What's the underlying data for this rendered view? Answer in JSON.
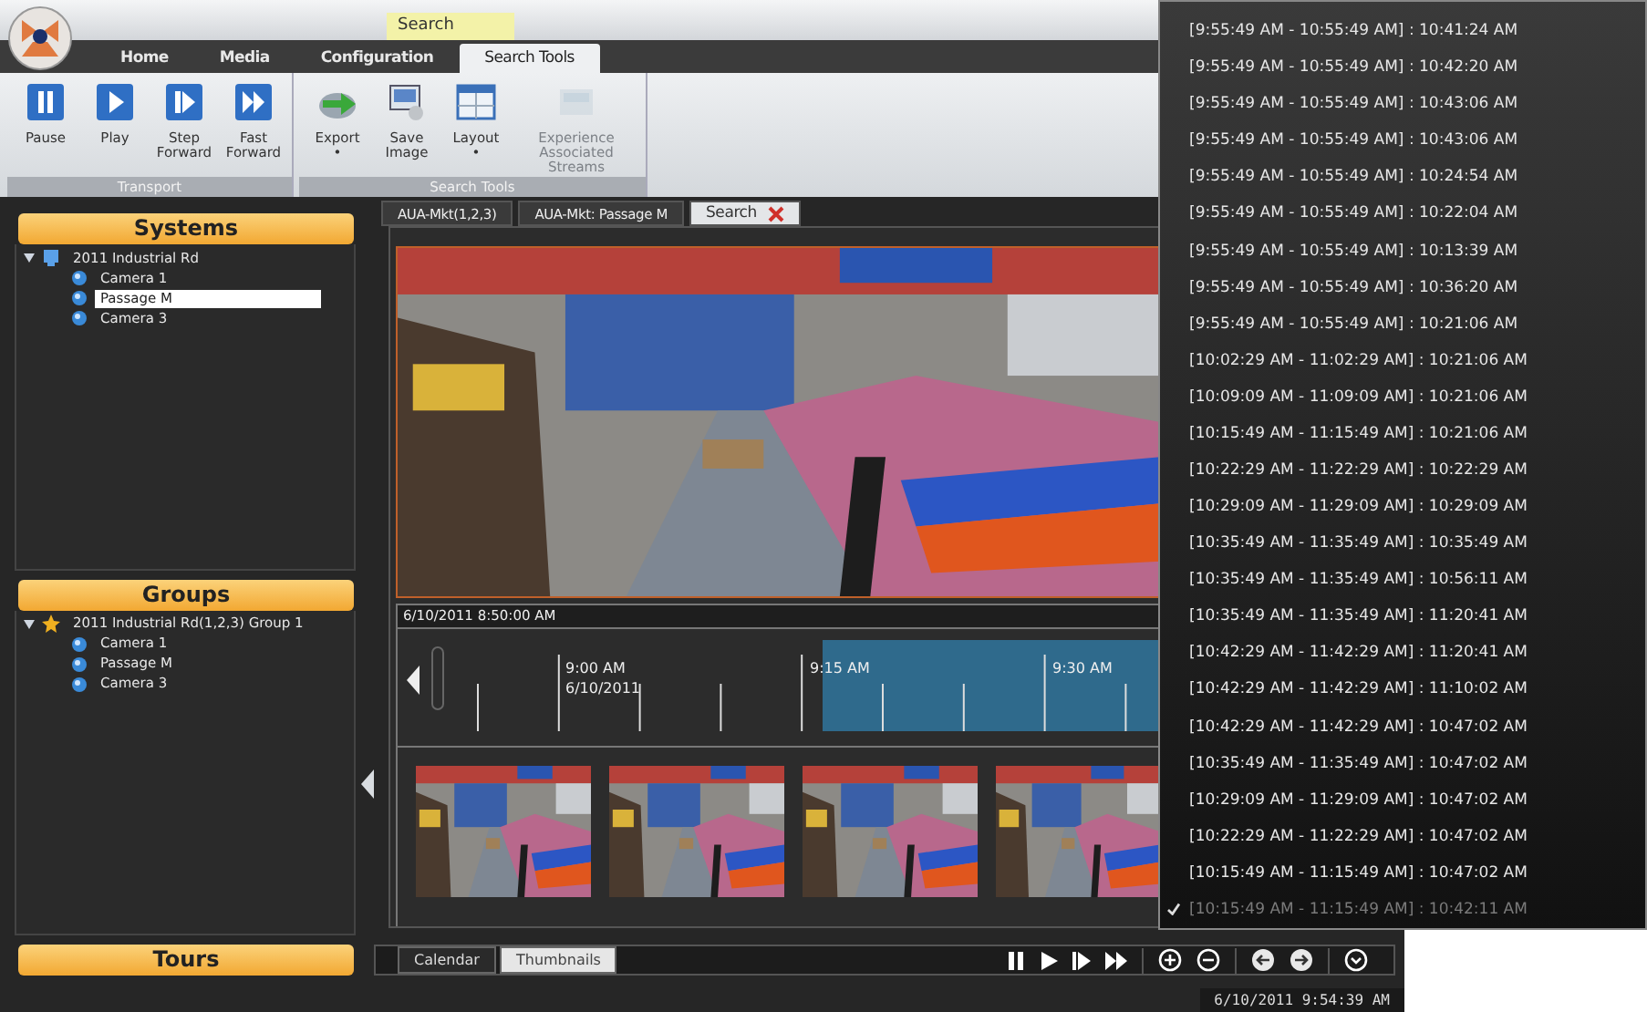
{
  "contextual_tab": {
    "label": "Search"
  },
  "ribbon_tabs": [
    {
      "label": "Home",
      "selected": false
    },
    {
      "label": "Media",
      "selected": false
    },
    {
      "label": "Configuration",
      "selected": false
    },
    {
      "label": "Search Tools",
      "selected": true
    }
  ],
  "ribbon_groups": [
    {
      "label": "Transport",
      "buttons": [
        {
          "label": "Pause",
          "kind": "pause",
          "disabled": false
        },
        {
          "label": "Play",
          "kind": "play",
          "disabled": false
        },
        {
          "label": "Step Forward",
          "kind": "step",
          "disabled": false
        },
        {
          "label": "Fast Forward",
          "kind": "fast",
          "disabled": false
        }
      ]
    },
    {
      "label": "Search Tools",
      "buttons": [
        {
          "label": "Export",
          "kind": "export",
          "dropdown": "•",
          "disabled": false
        },
        {
          "label": "Save Image",
          "kind": "save",
          "disabled": false
        },
        {
          "label": "Layout",
          "kind": "layout",
          "dropdown": "•",
          "disabled": false
        },
        {
          "label": "Experience Associated Streams",
          "kind": "streams",
          "disabled": true
        }
      ]
    }
  ],
  "sidebar": {
    "systems": {
      "title": "Systems",
      "tree": [
        {
          "label": "2011 Industrial Rd",
          "kind": "site",
          "expanded": true,
          "children": [
            {
              "label": "Camera 1",
              "kind": "camera",
              "selected": false
            },
            {
              "label": "Passage M",
              "kind": "camera",
              "selected": true
            },
            {
              "label": "Camera 3",
              "kind": "camera",
              "selected": false
            }
          ]
        }
      ]
    },
    "groups": {
      "title": "Groups",
      "tree": [
        {
          "label": "2011 Industrial Rd(1,2,3) Group 1",
          "kind": "group",
          "expanded": true,
          "children": [
            {
              "label": "Camera 1",
              "kind": "camera",
              "selected": false
            },
            {
              "label": "Passage M",
              "kind": "camera",
              "selected": false
            },
            {
              "label": "Camera 3",
              "kind": "camera",
              "selected": false
            }
          ]
        }
      ]
    },
    "tours": {
      "title": "Tours"
    }
  },
  "document_tabs": [
    {
      "label": "AUA-Mkt(1,2,3)",
      "selected": false,
      "closable": false
    },
    {
      "label": "AUA-Mkt: Passage M",
      "selected": false,
      "closable": false
    },
    {
      "label": "Search",
      "selected": true,
      "closable": true
    }
  ],
  "timeline": {
    "start": "6/10/2011 8:50:00 AM",
    "labels": [
      {
        "time": "9:00 AM",
        "date": "6/10/2011"
      },
      {
        "time": "9:15 AM"
      },
      {
        "time": "9:30 AM"
      }
    ]
  },
  "view_tabs": [
    {
      "label": "Calendar",
      "selected": false
    },
    {
      "label": "Thumbnails",
      "selected": true
    }
  ],
  "status": {
    "timestamp": "6/10/2011 9:54:39 AM"
  },
  "results": [
    {
      "label": "[9:55:49 AM - 10:55:49 AM] : 10:41:24 AM",
      "selected": false
    },
    {
      "label": "[9:55:49 AM - 10:55:49 AM] : 10:42:20 AM",
      "selected": false
    },
    {
      "label": "[9:55:49 AM - 10:55:49 AM] : 10:43:06 AM",
      "selected": false
    },
    {
      "label": "[9:55:49 AM - 10:55:49 AM] : 10:43:06 AM",
      "selected": false
    },
    {
      "label": "[9:55:49 AM - 10:55:49 AM] : 10:24:54 AM",
      "selected": false
    },
    {
      "label": "[9:55:49 AM - 10:55:49 AM] : 10:22:04 AM",
      "selected": false
    },
    {
      "label": "[9:55:49 AM - 10:55:49 AM] : 10:13:39 AM",
      "selected": false
    },
    {
      "label": "[9:55:49 AM - 10:55:49 AM] : 10:36:20 AM",
      "selected": false
    },
    {
      "label": "[9:55:49 AM - 10:55:49 AM] : 10:21:06 AM",
      "selected": false
    },
    {
      "label": "[10:02:29 AM - 11:02:29 AM] : 10:21:06 AM",
      "selected": false
    },
    {
      "label": "[10:09:09 AM - 11:09:09 AM] : 10:21:06 AM",
      "selected": false
    },
    {
      "label": "[10:15:49 AM - 11:15:49 AM] : 10:21:06 AM",
      "selected": false
    },
    {
      "label": "[10:22:29 AM - 11:22:29 AM] : 10:22:29 AM",
      "selected": false
    },
    {
      "label": "[10:29:09 AM - 11:29:09 AM] : 10:29:09 AM",
      "selected": false
    },
    {
      "label": "[10:35:49 AM - 11:35:49 AM] : 10:35:49 AM",
      "selected": false
    },
    {
      "label": "[10:35:49 AM - 11:35:49 AM] : 10:56:11 AM",
      "selected": false
    },
    {
      "label": "[10:35:49 AM - 11:35:49 AM] : 11:20:41 AM",
      "selected": false
    },
    {
      "label": "[10:42:29 AM - 11:42:29 AM] : 11:20:41 AM",
      "selected": false
    },
    {
      "label": "[10:42:29 AM - 11:42:29 AM] : 11:10:02 AM",
      "selected": false
    },
    {
      "label": "[10:42:29 AM - 11:42:29 AM] : 10:47:02 AM",
      "selected": false
    },
    {
      "label": "[10:35:49 AM - 11:35:49 AM] : 10:47:02 AM",
      "selected": false
    },
    {
      "label": "[10:29:09 AM - 11:29:09 AM] : 10:47:02 AM",
      "selected": false
    },
    {
      "label": "[10:22:29 AM - 11:22:29 AM] : 10:47:02 AM",
      "selected": false
    },
    {
      "label": "[10:15:49 AM - 11:15:49 AM] : 10:47:02 AM",
      "selected": false
    },
    {
      "label": "[10:15:49 AM - 11:15:49 AM] : 10:42:11 AM",
      "selected": true
    }
  ]
}
